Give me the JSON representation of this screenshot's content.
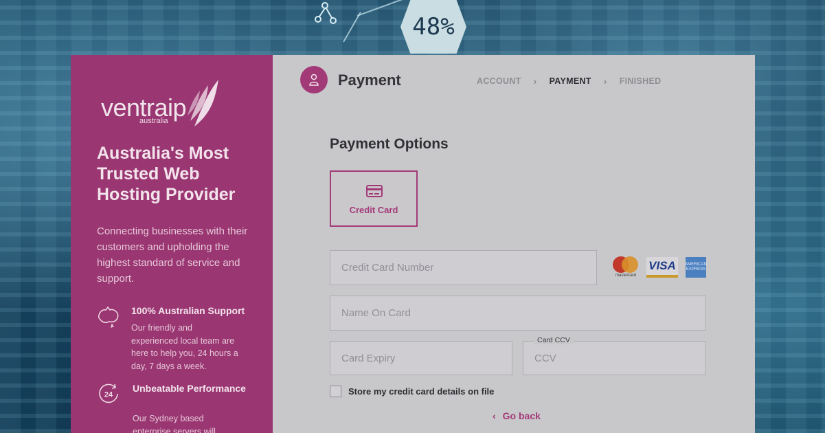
{
  "background": {
    "hexagon_text": "48%"
  },
  "sidebar": {
    "logo_text": "ventraip",
    "logo_sub": "australia",
    "headline": "Australia's Most Trusted Web Hosting Provider",
    "intro": "Connecting businesses with their customers and upholding the highest standard of service and support.",
    "features": [
      {
        "icon": "australia-map-icon",
        "title": "100% Australian Support",
        "description": "Our friendly and experienced local team are here to help you, 24 hours a day, 7 days a week."
      },
      {
        "icon": "24-hour-icon",
        "icon_text": "24",
        "title": "Unbeatable Performance",
        "description": "Our Sydney based enterprise servers will"
      }
    ]
  },
  "header": {
    "title": "Payment",
    "steps": [
      {
        "label": "ACCOUNT",
        "state": "done"
      },
      {
        "label": "PAYMENT",
        "state": "active"
      },
      {
        "label": "FINISHED",
        "state": "pending"
      }
    ]
  },
  "payment": {
    "section_title": "Payment Options",
    "options": [
      {
        "label": "Credit Card",
        "selected": true
      }
    ],
    "fields": {
      "card_number": {
        "placeholder": "Credit Card Number",
        "value": ""
      },
      "name_on_card": {
        "placeholder": "Name On Card",
        "value": ""
      },
      "card_expiry": {
        "placeholder": "Card Expiry",
        "value": ""
      },
      "card_ccv": {
        "label": "Card CCV",
        "placeholder": "CCV",
        "value": ""
      }
    },
    "card_brands": {
      "mastercard": "mastercard",
      "visa": "VISA",
      "amex": "AMERICAN EXPRESS"
    },
    "store_details_label": "Store my credit card details on file",
    "store_details_checked": false,
    "go_back_label": "Go back"
  },
  "colors": {
    "brand": "#a33a78",
    "sidebar": "#9a3672",
    "panel": "#c8c7ca"
  }
}
